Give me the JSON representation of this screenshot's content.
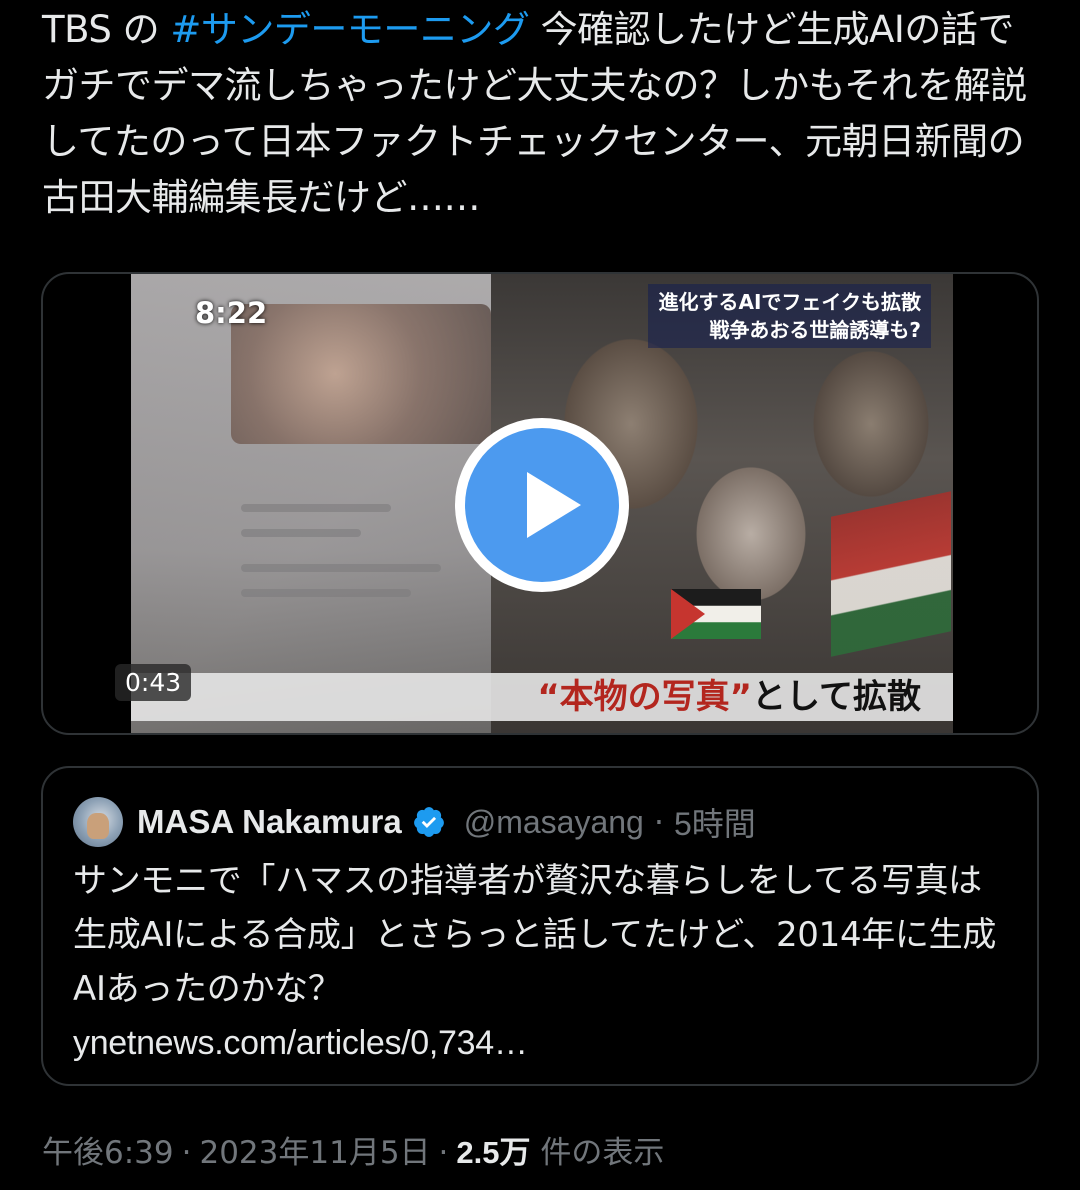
{
  "tweet": {
    "text_before": "TBS の ",
    "hashtag": "#サンデーモーニング",
    "text_after": " 今確認したけど生成AIの話でガチでデマ流しちゃったけど大丈夫なの？しかもそれを解説してたのって日本ファクトチェックセンター、元朝日新聞の古田大輔編集長だけど……"
  },
  "video": {
    "timestamp_overlay": "8:22",
    "caption_top_line1": "進化するAIでフェイクも拡散",
    "caption_top_line2": "戦争あおる世論誘導も?",
    "subtitle_red": "“本物の写真”",
    "subtitle_rest": "として拡散",
    "duration": "0:43",
    "play_icon": "play-icon"
  },
  "quote": {
    "name": "MASA Nakamura",
    "handle": "@masayang",
    "separator": "·",
    "time": "5時間",
    "body": "サンモニで「ハマスの指導者が贅沢な暮らしをしてる写真は生成AIによる合成」とさらっと話してたけど、2014年に生成AIあったのかな？",
    "link": "ynetnews.com/articles/0,734…",
    "verified_color": "#1d9bf0"
  },
  "meta": {
    "time": "午後6:39",
    "separator": "·",
    "date": "2023年11月5日",
    "views_count": "2.5万",
    "views_label": "件の表示"
  },
  "colors": {
    "background": "#000000",
    "text": "#e7e9ea",
    "muted": "#71767b",
    "accent": "#1d9bf0",
    "play_button": "#4c9aef"
  }
}
